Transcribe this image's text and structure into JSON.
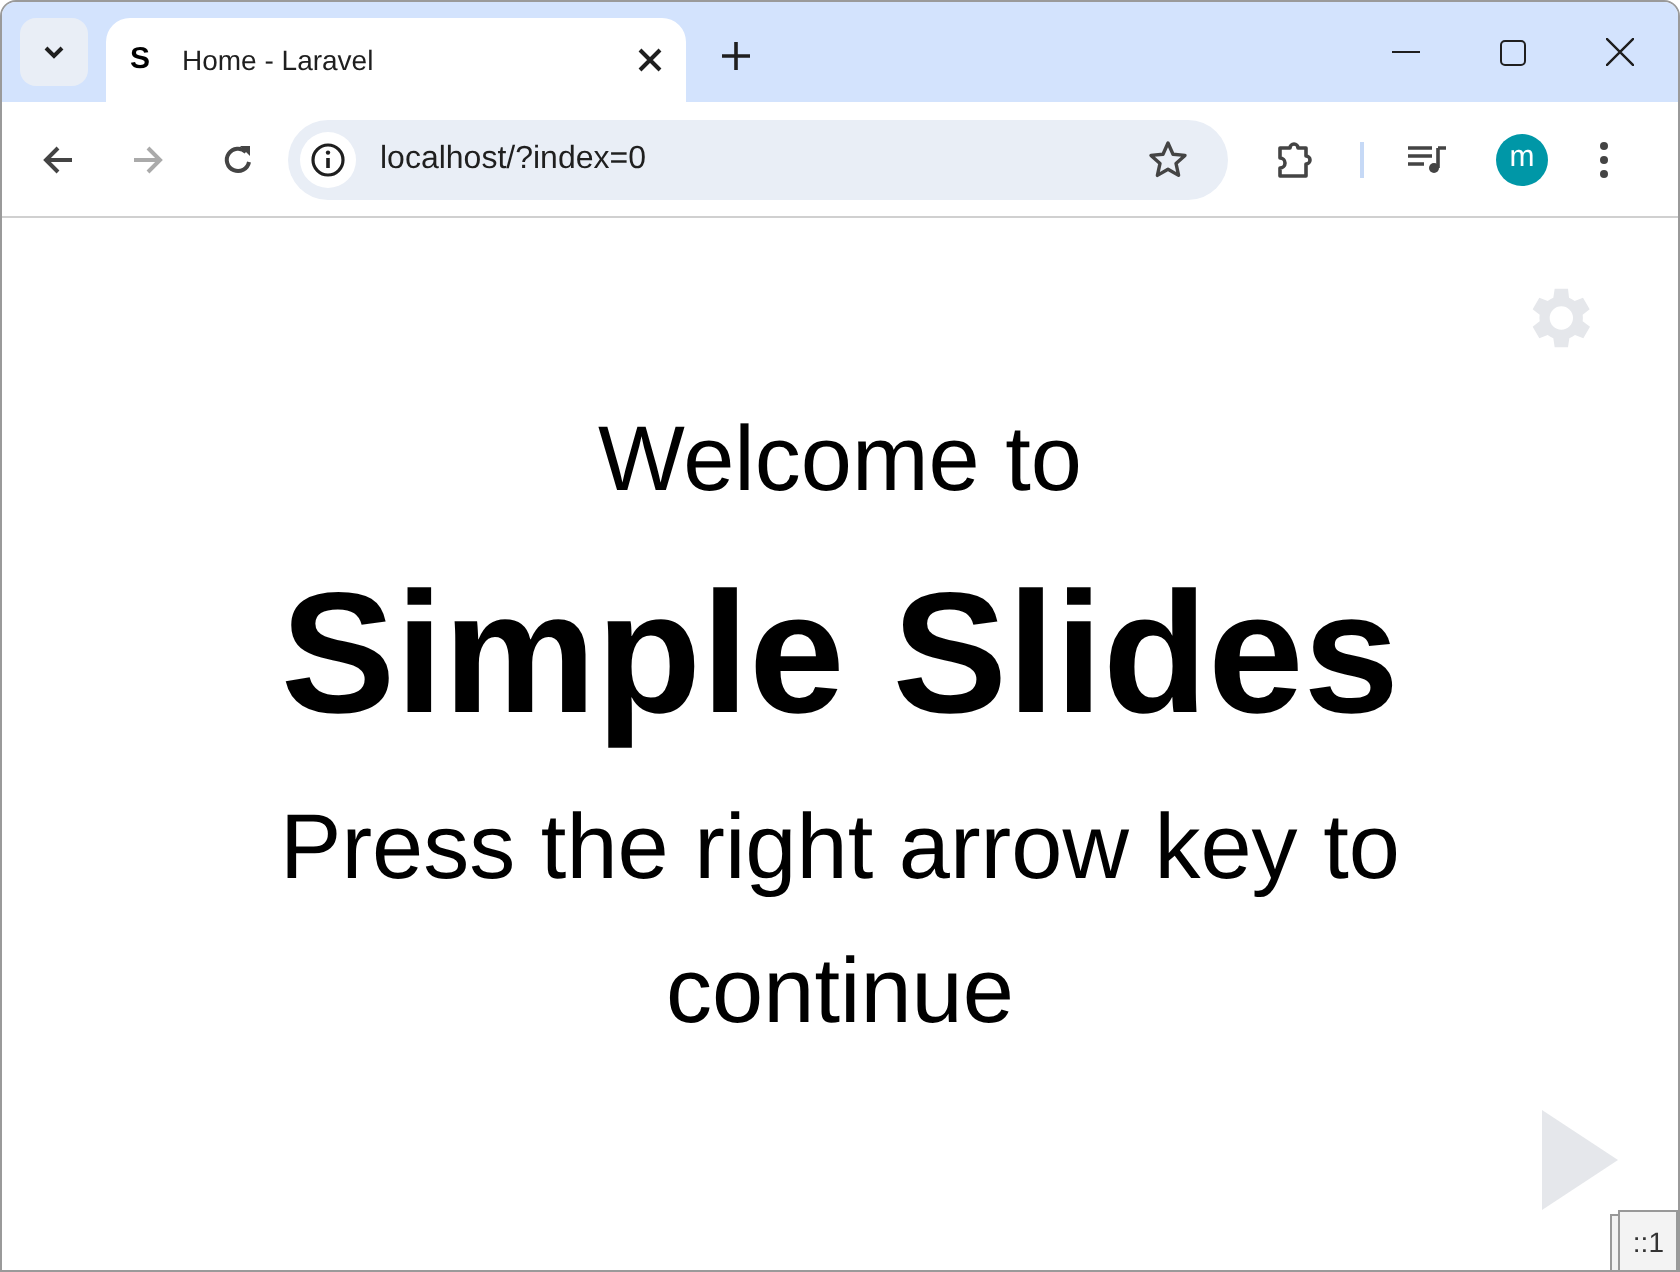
{
  "tab": {
    "favicon": "S",
    "title": "Home - Laravel",
    "selected": true
  },
  "toolbar": {
    "url": "localhost/?index=0",
    "profile_initial": "m"
  },
  "slide": {
    "intro": "Welcome to",
    "title": "Simple Slides",
    "instruction": "Press the right arrow key to continue"
  },
  "debug_badge": "::1"
}
